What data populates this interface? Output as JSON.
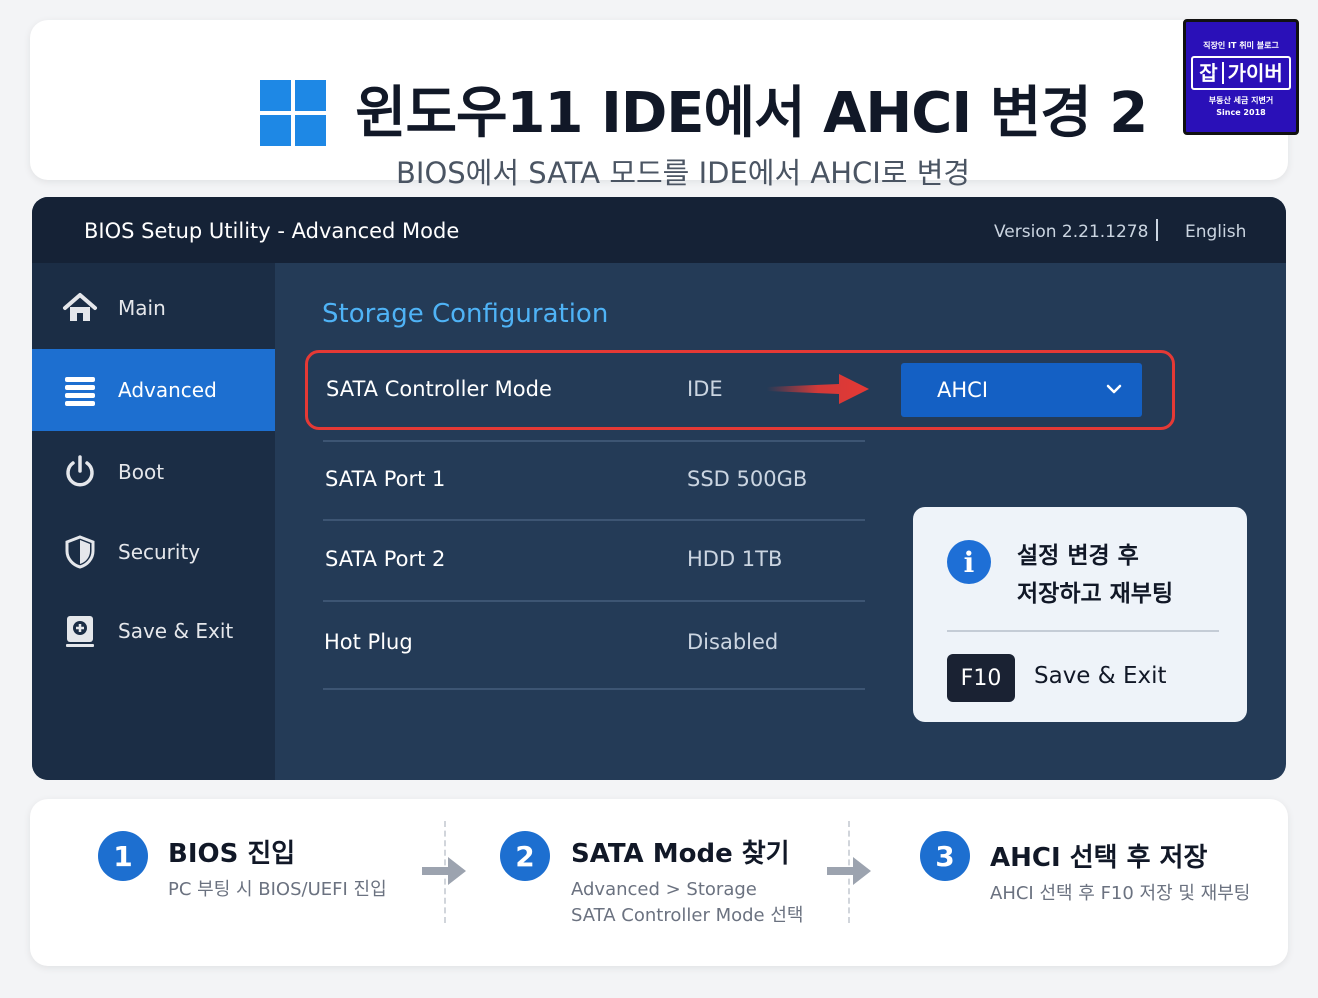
{
  "header": {
    "title": "윈도우11 IDE에서 AHCI 변경 2",
    "subtitle": "BIOS에서 SATA 모드를 IDE에서 AHCI로 변경"
  },
  "badge": {
    "top": "직장인 IT 취미 블로그",
    "left": "잡",
    "right": "가이버",
    "bottom": "부동산 세금 지변거",
    "since": "Since 2018"
  },
  "bios": {
    "title": "BIOS Setup Utility  -  Advanced Mode",
    "version": "Version 2.21.1278",
    "language": "English",
    "sidebar": [
      {
        "label": "Main",
        "icon": "home-icon"
      },
      {
        "label": "Advanced",
        "icon": "list-icon",
        "active": true
      },
      {
        "label": "Boot",
        "icon": "power-icon"
      },
      {
        "label": "Security",
        "icon": "shield-icon"
      },
      {
        "label": "Save & Exit",
        "icon": "save-exit-icon"
      }
    ],
    "section_title": "Storage Configuration",
    "rows": [
      {
        "label": "SATA Controller Mode",
        "value": "IDE",
        "selected": "AHCI"
      },
      {
        "label": "SATA Port 1",
        "value": "SSD  500GB"
      },
      {
        "label": "SATA Port 2",
        "value": "HDD  1TB"
      },
      {
        "label": "Hot Plug",
        "value": "Disabled"
      }
    ],
    "info": {
      "line1": "설정 변경 후",
      "line2": "저장하고 재부팅",
      "key": "F10",
      "key_label": "Save & Exit"
    }
  },
  "steps": [
    {
      "num": "1",
      "title": "BIOS 진입",
      "desc1": "PC 부팅 시 BIOS/UEFI 진입",
      "desc2": ""
    },
    {
      "num": "2",
      "title": "SATA Mode 찾기",
      "desc1": "Advanced > Storage",
      "desc2": "SATA Controller Mode 선택"
    },
    {
      "num": "3",
      "title": "AHCI 선택 후 저장",
      "desc1": "AHCI 선택 후 F10 저장 및 재부팅",
      "desc2": ""
    }
  ],
  "colors": {
    "accent": "#1d6fd0",
    "highlight": "#e53935",
    "bios_bg": "#243b57",
    "sidebar_bg": "#1b2d45"
  }
}
